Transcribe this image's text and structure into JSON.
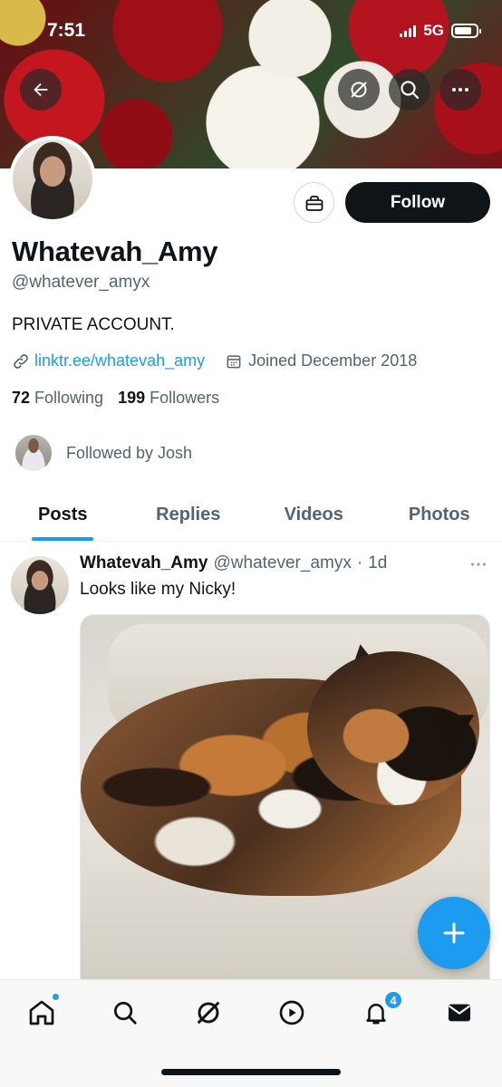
{
  "status_bar": {
    "time": "7:51",
    "network": "5G"
  },
  "profile": {
    "display_name": "Whatevah_Amy",
    "handle": "@whatever_amyx",
    "bio": "PRIVATE ACCOUNT.",
    "link": "linktr.ee/whatevah_amy",
    "joined": "Joined December 2018",
    "following_count": "72",
    "following_label": "Following",
    "followers_count": "199",
    "followers_label": "Followers",
    "followed_by": "Followed by Josh",
    "follow_button": "Follow"
  },
  "tabs": [
    {
      "label": "Posts",
      "active": true
    },
    {
      "label": "Replies",
      "active": false
    },
    {
      "label": "Videos",
      "active": false
    },
    {
      "label": "Photos",
      "active": false
    }
  ],
  "post": {
    "author_name": "Whatevah_Amy",
    "author_handle": "@whatever_amyx",
    "separator": "·",
    "time": "1d",
    "text": "Looks like my Nicky!"
  },
  "bottom_nav": {
    "items": [
      "home-icon",
      "search-icon",
      "grok-icon",
      "video-icon",
      "notifications-icon",
      "messages-icon"
    ],
    "notification_badge": "4"
  },
  "colors": {
    "accent": "#1d9bf0",
    "text": "#0f1419",
    "secondary": "#536471"
  }
}
